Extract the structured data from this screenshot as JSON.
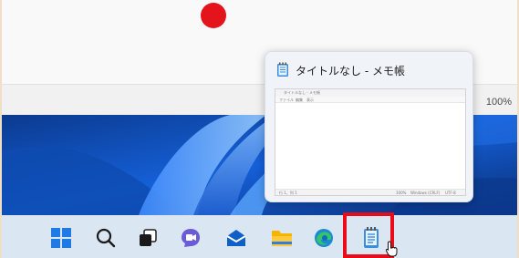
{
  "notepad": {
    "zoom": "100%"
  },
  "preview": {
    "title": "タイトルなし - メモ帳",
    "app_icon": "notepad-icon",
    "mini_window": {
      "title": "タイトルなし - メモ帳",
      "menu": [
        "ファイル",
        "編集",
        "表示"
      ],
      "status_position": "行 1、列 1",
      "status_zoom": "100%",
      "status_lineending": "Windows (CRLF)",
      "status_encoding": "UTF-8"
    }
  },
  "taskbar": {
    "icons": [
      "start-icon",
      "search-icon",
      "task-view-icon",
      "chat-icon",
      "mail-icon",
      "file-explorer-icon",
      "edge-icon",
      "notepad-icon"
    ],
    "active_app": "notepad-icon"
  },
  "colors": {
    "highlight": "#e80c1a",
    "record_dot": "#e4141c",
    "taskbar": "#dbe6f3",
    "wallpaper": "#0d3f9c"
  }
}
